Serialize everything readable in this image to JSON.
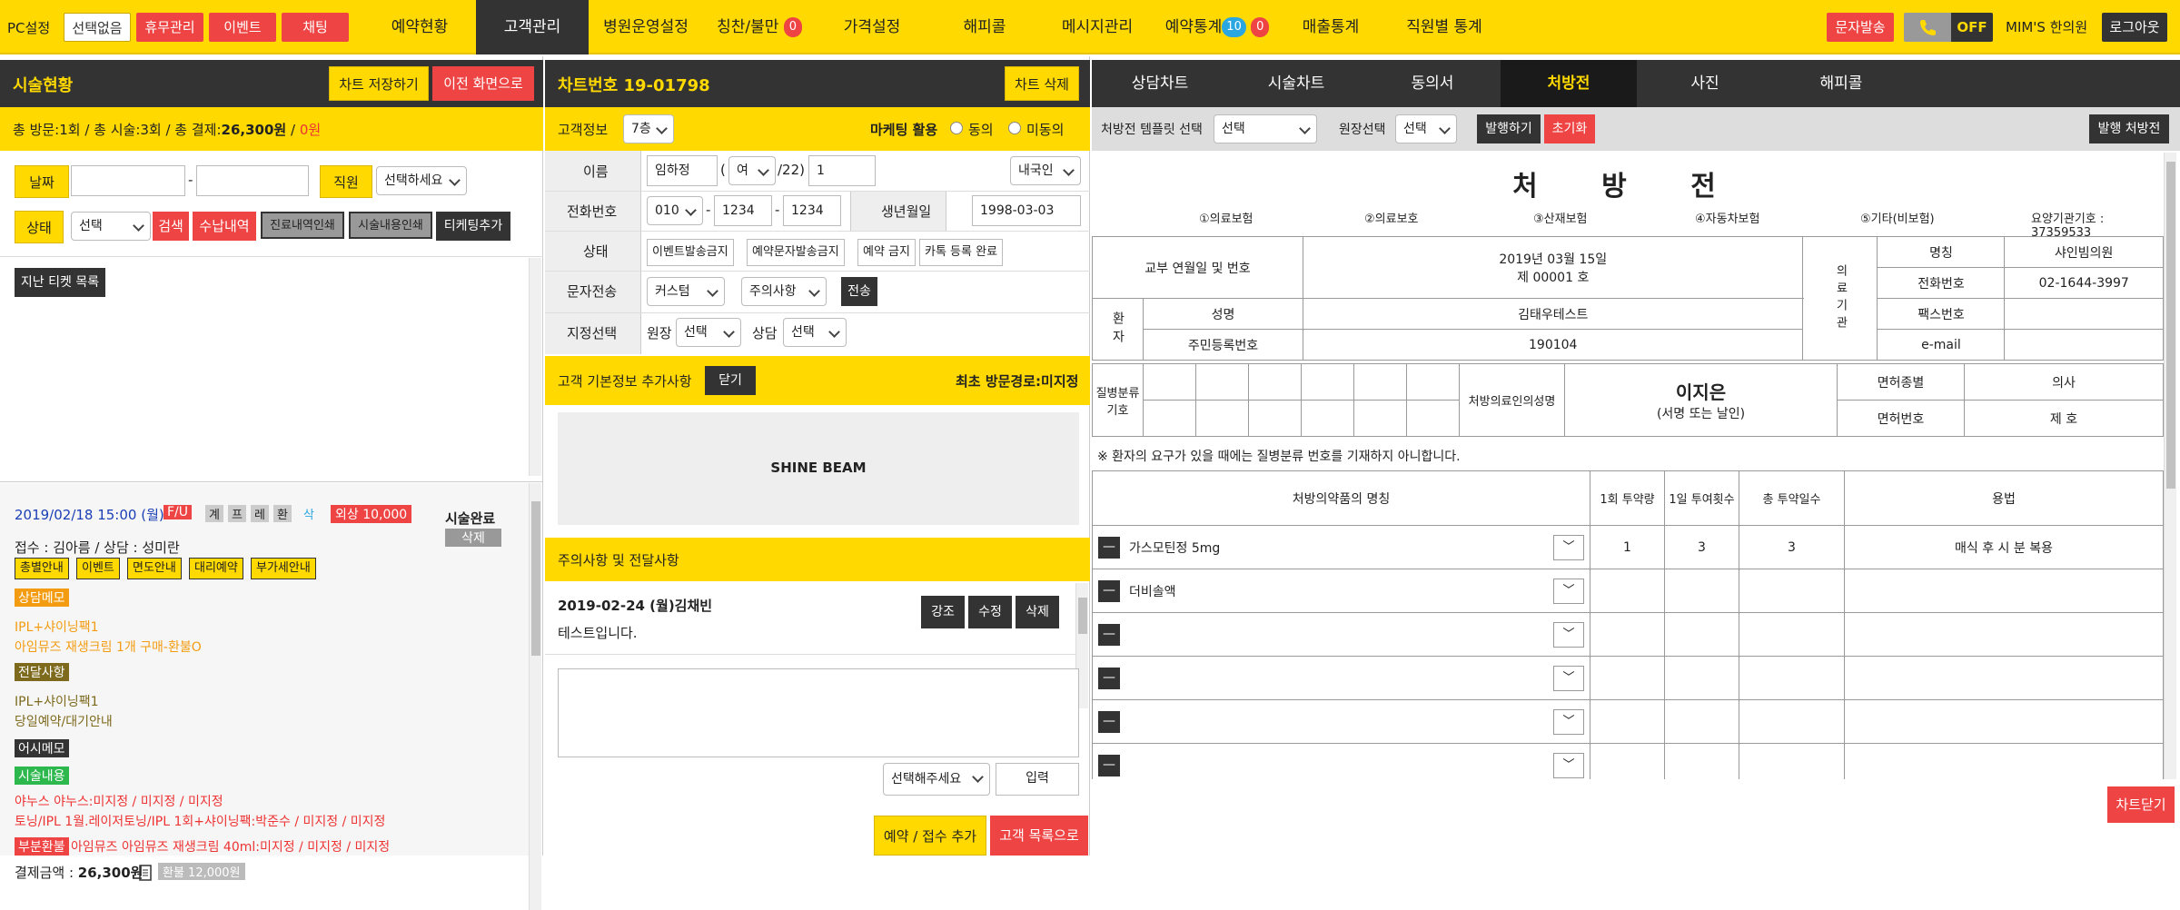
{
  "topbar": {
    "pc_setting": "PC설정",
    "select_none": "선택없음",
    "btn_rest": "휴무관리",
    "btn_event": "이벤트",
    "btn_chat": "채팅",
    "nav": [
      "예약현황",
      "고객관리",
      "병원운영설정",
      "칭찬/불만",
      "가격설정",
      "해피콜",
      "메시지관리",
      "예약통계",
      "매출통계",
      "직원별 통계"
    ],
    "praise_badge": "0",
    "stat_badge_blue": "10",
    "stat_badge_red": "0",
    "sms_btn": "문자발송",
    "off_label": "OFF",
    "clinic_name": "MIM'S 한의원",
    "logout": "로그아웃"
  },
  "left": {
    "title": "시술현황",
    "save_chart": "차트 저장하기",
    "prev_screen": "이전 화면으로",
    "summary": "총 방문:1회 / 총 시술:3회 / 총 결제:",
    "summary_amount": "26,300원",
    "summary_sep": " / ",
    "summary_unpaid": "0원",
    "date_label": "날짜",
    "date_dash": "-",
    "staff_label": "직원",
    "staff_select": "선택하세요",
    "status_label": "상태",
    "status_select": "선택",
    "btn_search": "검색",
    "btn_payment": "수납내역",
    "btn_print_treat": "진료내역인쇄",
    "btn_print_proc": "시술내용인쇄",
    "btn_ticket_add": "티케팅추가",
    "past_ticket": "지난 티켓 목록",
    "visit": {
      "date": "2019/02/18 15:00 (월)",
      "fu": "F/U",
      "marks": [
        "계",
        "프",
        "레",
        "환"
      ],
      "del_mark": "삭",
      "credit": "외상 10,000",
      "status": "시술완료",
      "delete": "삭제",
      "reception": "접수 : 김아름 / 상담 : 성미란",
      "guide_tags": [
        "총별안내",
        "이벤트",
        "면도안내",
        "대리예약",
        "부가세안내"
      ],
      "consult_memo_label": "상담메모",
      "consult_memo": [
        "IPL+샤이닝팩1",
        "아임뮤즈 재생크림 1개 구매-환불O"
      ],
      "notice_label": "전달사항",
      "notice": [
        "IPL+샤이닝팩1",
        "당일예약/대기안내"
      ],
      "deski_memo_label": "어시메모",
      "procedure_label": "시술내용",
      "procedure": [
        "야누스 야누스:미지정 / 미지정 / 미지정",
        "토닝/IPL 1월.레이저토닝/IPL 1회+샤이닝팩:박준수 / 미지정 / 미지정"
      ],
      "partial_refund_label": "부분환불",
      "partial_refund": "아임뮤즈 아임뮤즈 재생크림 40ml:미지정 / 미지정 / 미지정",
      "pay_label": "결제금액 : ",
      "pay_amount": "26,300원",
      "refund": "환불 12,000원"
    }
  },
  "middle": {
    "chart_no": "차트번호 19-01798",
    "chart_delete": "차트 삭제",
    "cust_info": "고객정보",
    "floor": "7층",
    "marketing": "마케팅 활용",
    "agree": "동의",
    "disagree": "미동의",
    "name_label": "이름",
    "name_value": "임하정",
    "gender": "여",
    "age_sep": "/22)",
    "paren_open": "(",
    "count": "1",
    "nationality": "내국인",
    "phone_label": "전화번호",
    "phone1": "010",
    "phone2": "1234",
    "phone3": "1234",
    "dash": "-",
    "birth_label": "생년월일",
    "birth_value": "1998-03-03",
    "status_label": "상태",
    "status_tags": [
      "이벤트발송금지",
      "예약문자발송금지",
      "예약 금지",
      "카톡 등록 완료"
    ],
    "sms_label": "문자전송",
    "sms_sel1": "커스텀",
    "sms_sel2": "주의사항",
    "sms_send": "전송",
    "assign_label": "지정선택",
    "director": "원장",
    "director_sel": "선택",
    "counsel": "상담",
    "counsel_sel": "선택",
    "extra_info": "고객 기본정보 추가사항",
    "close": "닫기",
    "first_path": "최초 방문경로:미지정",
    "shine_beam": "SHINE BEAM",
    "caution_title": "주의사항 및 전달사항",
    "note_author": "2019-02-24 (월)김채빈",
    "note_text": "테스트입니다.",
    "emph": "강조",
    "edit": "수정",
    "del": "삭제",
    "select_please": "선택해주세요",
    "input": "입력",
    "add_reserv": "예약 / 접수 추가",
    "to_list": "고객 목록으로"
  },
  "right": {
    "tabs": [
      "상담차트",
      "시술차트",
      "동의서",
      "처방전",
      "사진",
      "해피콜"
    ],
    "template_label": "처방전 템플릿 선택",
    "template_sel": "선택",
    "director_label": "원장선택",
    "director_sel": "선택",
    "issue": "발행하기",
    "reset": "초기화",
    "issued": "발행 처방전",
    "rx_title": "처 방 전",
    "insurance": [
      "①의료보험",
      "②의료보호",
      "③산재보험",
      "④자동차보험",
      "⑤기타(비보험)"
    ],
    "institution_no": "요양기관기호 : 37359533",
    "issue_date_label": "교부 연월일 및 번호",
    "issue_date": "2019년 03월 15일",
    "issue_no": "제     00001 호",
    "med_inst": "의료기관",
    "inst_name_label": "명칭",
    "inst_name": "샤인빔의원",
    "inst_phone_label": "전화번호",
    "inst_phone": "02-1644-3997",
    "fax_label": "팩스번호",
    "email_label": "e-mail",
    "patient": "환자",
    "pname_label": "성명",
    "pname": "김태우테스트",
    "rrn_label": "주민등록번호",
    "rrn": "190104",
    "disease_code": "질병분류기호",
    "prescriber_label": "처방의료인의성명",
    "prescriber": "이지은",
    "prescriber_sub": "(서명 또는 날인)",
    "license_type_label": "면허종별",
    "license_type": "의사",
    "license_no_label": "면허번호",
    "license_no": "제            호",
    "note": "※ 환자의 요구가 있을 때에는 질병분류 번호를 기재하지 아니합니다.",
    "col_drug": "처방의약품의 명칭",
    "col_dose": "1회 투약량",
    "col_daily": "1일 투여횟수",
    "col_days": "총 투약일수",
    "col_usage": "용법",
    "drugs": [
      {
        "name": "가스모틴정 5mg",
        "dose": "1",
        "daily": "3",
        "days": "3",
        "usage": "매식 후 시 분 복용"
      },
      {
        "name": "더비솔액",
        "dose": "",
        "daily": "",
        "days": "",
        "usage": ""
      },
      {
        "name": "",
        "dose": "",
        "daily": "",
        "days": "",
        "usage": ""
      },
      {
        "name": "",
        "dose": "",
        "daily": "",
        "days": "",
        "usage": ""
      },
      {
        "name": "",
        "dose": "",
        "daily": "",
        "days": "",
        "usage": ""
      },
      {
        "name": "",
        "dose": "",
        "daily": "",
        "days": "",
        "usage": ""
      }
    ],
    "close_chart": "차트닫기"
  }
}
